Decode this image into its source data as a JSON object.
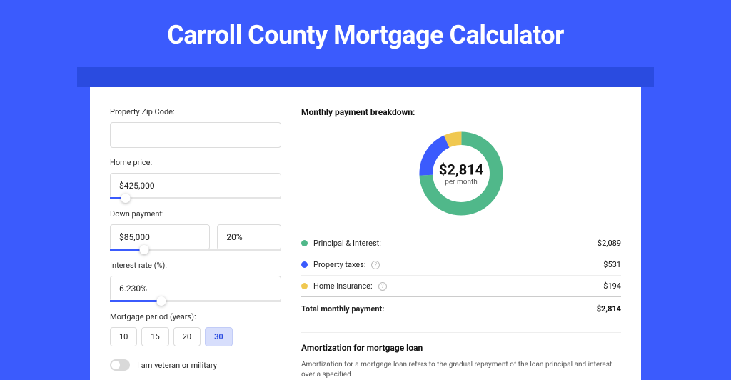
{
  "title": "Carroll County Mortgage Calculator",
  "form": {
    "zip_label": "Property Zip Code:",
    "zip_value": "",
    "home_price_label": "Home price:",
    "home_price_value": "$425,000",
    "home_price_slider_pct": 9,
    "down_payment_label": "Down payment:",
    "down_payment_value": "$85,000",
    "down_payment_pct": "20%",
    "down_payment_slider_pct": 20,
    "interest_label": "Interest rate (%):",
    "interest_value": "6.230%",
    "interest_slider_pct": 30,
    "period_label": "Mortgage period (years):",
    "periods": [
      "10",
      "15",
      "20",
      "30"
    ],
    "period_active": "30",
    "veteran_label": "I am veteran or military"
  },
  "breakdown": {
    "heading": "Monthly payment breakdown:",
    "total_value": "$2,814",
    "total_sub": "per month",
    "items": [
      {
        "label": "Principal & Interest:",
        "value": "$2,089",
        "color": "green",
        "info": false
      },
      {
        "label": "Property taxes:",
        "value": "$531",
        "color": "blue",
        "info": true
      },
      {
        "label": "Home insurance:",
        "value": "$194",
        "color": "yellow",
        "info": true
      }
    ],
    "total_label": "Total monthly payment:",
    "total_amount": "$2,814"
  },
  "amort": {
    "heading": "Amortization for mortgage loan",
    "text": "Amortization for a mortgage loan refers to the gradual repayment of the loan principal and interest over a specified"
  },
  "chart_data": {
    "type": "pie",
    "title": "Monthly payment breakdown",
    "series": [
      {
        "name": "Principal & Interest",
        "value": 2089,
        "color": "#50b88a"
      },
      {
        "name": "Property taxes",
        "value": 531,
        "color": "#3b5bfd"
      },
      {
        "name": "Home insurance",
        "value": 194,
        "color": "#f0c850"
      }
    ],
    "total": 2814,
    "center_label": "$2,814 per month"
  }
}
